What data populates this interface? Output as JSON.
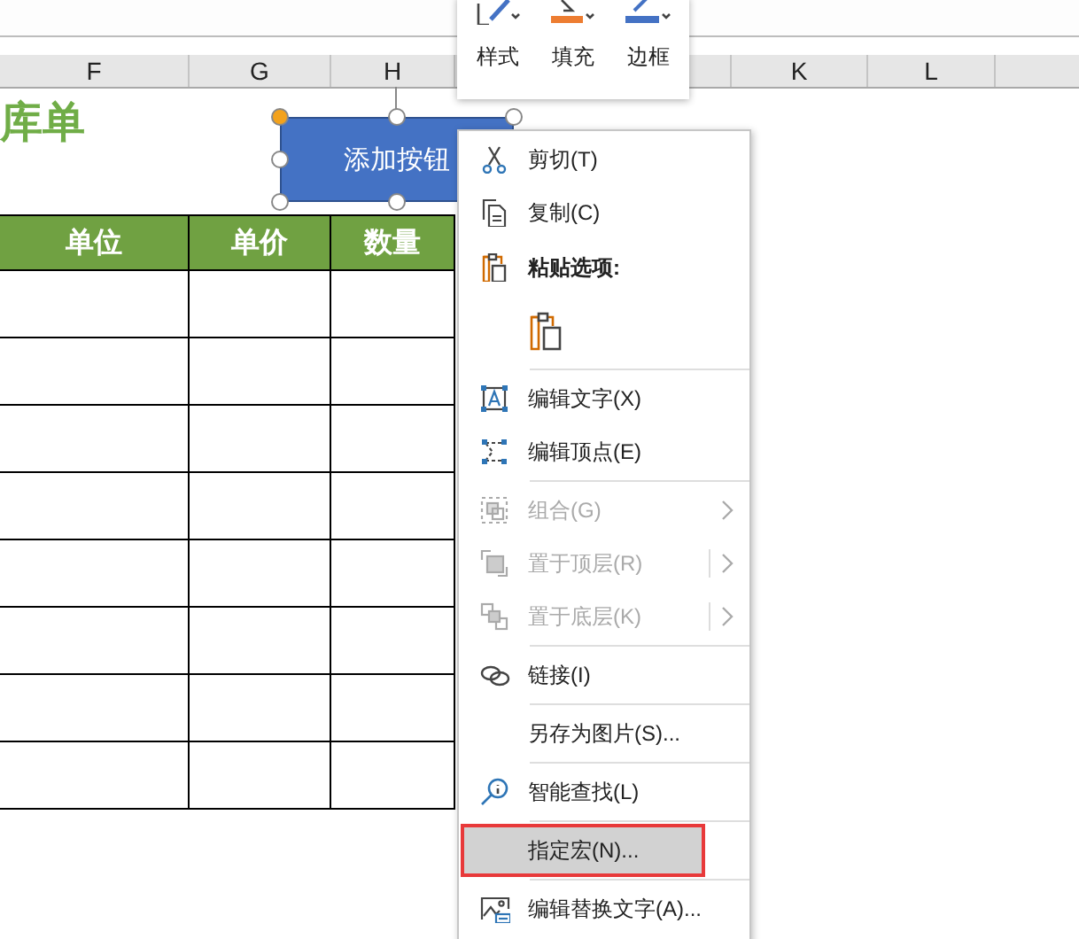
{
  "sheet": {
    "columns": [
      {
        "label": "F"
      },
      {
        "label": "G"
      },
      {
        "label": "H"
      },
      {},
      {},
      {
        "label": "K"
      },
      {
        "label": "L"
      },
      {}
    ],
    "title": "库单",
    "table": {
      "headers": [
        "单位",
        "单价",
        "数量"
      ]
    }
  },
  "shape": {
    "text": "添加按钮",
    "selected": true
  },
  "mini_toolbar": [
    {
      "label": "样式",
      "kind": "style"
    },
    {
      "label": "填充",
      "kind": "fill"
    },
    {
      "label": "边框",
      "kind": "border"
    }
  ],
  "context_menu": [
    {
      "kind": "item",
      "label": "剪切(T)",
      "disabled": false,
      "selected": false
    },
    {
      "kind": "item",
      "label": "复制(C)",
      "disabled": false,
      "selected": false
    },
    {
      "kind": "header",
      "label": "粘贴选项:"
    },
    {
      "kind": "paste-options"
    },
    {
      "kind": "separator"
    },
    {
      "kind": "item",
      "label": "编辑文字(X)",
      "disabled": false,
      "selected": false
    },
    {
      "kind": "item",
      "label": "编辑顶点(E)",
      "disabled": false,
      "selected": false
    },
    {
      "kind": "separator"
    },
    {
      "kind": "item",
      "label": "组合(G)",
      "disabled": true,
      "selected": false,
      "has_submenu": true,
      "split": false
    },
    {
      "kind": "item",
      "label": "置于顶层(R)",
      "disabled": true,
      "selected": false,
      "has_submenu": true,
      "split": true
    },
    {
      "kind": "item",
      "label": "置于底层(K)",
      "disabled": true,
      "selected": false,
      "has_submenu": true,
      "split": true
    },
    {
      "kind": "separator"
    },
    {
      "kind": "item",
      "label": "链接(I)",
      "disabled": false,
      "selected": false
    },
    {
      "kind": "separator"
    },
    {
      "kind": "item",
      "label": "另存为图片(S)...",
      "disabled": false,
      "selected": false
    },
    {
      "kind": "separator"
    },
    {
      "kind": "item",
      "label": "智能查找(L)",
      "disabled": false,
      "selected": false
    },
    {
      "kind": "separator"
    },
    {
      "kind": "item",
      "label": "指定宏(N)...",
      "disabled": false,
      "selected": true,
      "outlined": true
    },
    {
      "kind": "separator"
    },
    {
      "kind": "item",
      "label": "编辑替换文字(A)...",
      "disabled": false,
      "selected": false
    }
  ]
}
